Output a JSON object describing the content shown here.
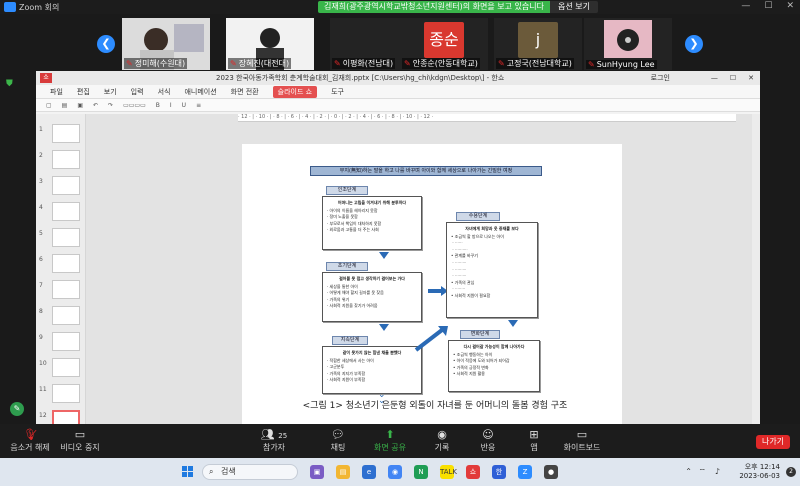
{
  "zoom": {
    "title": "Zoom 회의",
    "share_banner": "김재희(광주광역시학교밖청소년지원센터)의 화면을 보고 있습니다",
    "view_options": "옵션 보기",
    "participants": [
      {
        "name": "정미해(수원대)",
        "muted": true
      },
      {
        "name": "장혜진(대전대)",
        "muted": true
      },
      {
        "name": "이평화(전남대)",
        "muted": true
      },
      {
        "name": "안종순(안동대학교)",
        "muted": true,
        "initials": "종순",
        "color": "#d9382f"
      },
      {
        "name": "고정국(전남대학교)",
        "muted": true,
        "initials": "j",
        "color": "#6b5a3a"
      },
      {
        "name": "SunHyung Lee",
        "muted": true
      }
    ],
    "toolbar": {
      "unmute": "음소거 해제",
      "stop_video": "비디오 중지",
      "participants": "참가자",
      "participant_count": "25",
      "chat": "채팅",
      "share": "화면 공유",
      "record": "기록",
      "reactions": "반응",
      "apps": "앱",
      "whiteboard": "화이트보드",
      "leave": "나가기"
    }
  },
  "hwp": {
    "app_icon": "쇼",
    "doc_title": "2023 한국아동가족학회 춘계학술대회_김재희.pptx [C:\\Users\\hg_chi\\kdgn\\Desktop\\] - 한쇼",
    "login": "로그인",
    "menus": [
      "파일",
      "편집",
      "보기",
      "입력",
      "서식",
      "애니메이션",
      "화면 전환",
      "슬라이드 쇼",
      "도구"
    ],
    "active_menu_index": 7,
    "slide_numbers": [
      "1",
      "2",
      "3",
      "4",
      "5",
      "6",
      "7",
      "8",
      "9",
      "10",
      "11",
      "12"
    ],
    "selected_slide": "12",
    "ruler": "· 12 · | · 10 · | · 8 · | · 6 · | · 4 · | · 2 · | · 0 · | · 2 · | · 4 · | · 6 · | · 8 · | · 10 · | · 12 ·"
  },
  "diagram": {
    "header": "무지(無知)하는 말을 하고 나를 바꾸며 아이와 함께 세상으로 나아가는 긴밀한 여정",
    "stages": [
      {
        "label": "인조단계",
        "box_title": "어머니는 고립을 이겨내기 위해 분투하다",
        "items": [
          "아이의 이름을 헤아리지 못함",
          "정미 노출을 못함",
          "부모로서 책임이 대처하지 못함",
          "외로움과 고통을 더 주는 사회"
        ]
      },
      {
        "label": "초기단계",
        "box_title": "걸어볼 못 접고 생각하기 걸어보는 가다",
        "items": [
          "세상을 통한 아이",
          "어떻게 해야 할지 길자를 못 찾음",
          "가족의 위기",
          "사회적 지원을 찾기가 어려움"
        ]
      },
      {
        "label": "지속단계",
        "box_title": "같이 못가지 않는 힘낸 채울 뿐했다",
        "items": [
          "적합한 세상에서 사는 아이",
          "고군분투",
          "가족의 지지가 부족함",
          "사회적 지원이 부족함"
        ]
      },
      {
        "label": "수용단계",
        "box_title": "자녀에게 희망과 옷 중재를 보다",
        "items": [
          "조금씩 할 방으로 나오는 아이",
          "관계를 바꾸기",
          "가족의 관심",
          "사회적 지원이 필요함"
        ]
      },
      {
        "label": "변화단계",
        "box_title": "다시 걸어갈 가능성이 함께 나아가다",
        "items": [
          "조금씩 행동하는 아이",
          "아이 적응에 도와 되어가 되어감",
          "가족의 긍정적 변화",
          "사회적 지원 활용"
        ]
      }
    ],
    "caption": "<그림 1> 청소년기 은둔형 외톨이 자녀를 둔 어머니의 돌봄 경험 구조"
  },
  "taskbar": {
    "search_placeholder": "검색",
    "time": "오후 12:14",
    "date": "2023-06-03",
    "notifications": "2"
  }
}
